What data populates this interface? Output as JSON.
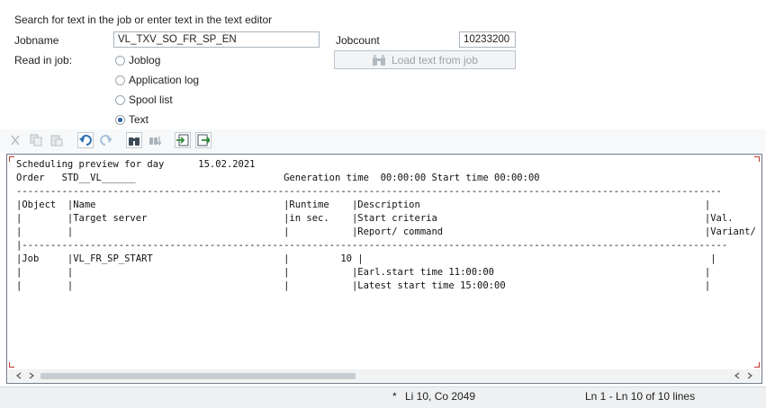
{
  "form": {
    "instruction": "Search for text in the job or enter text in the text editor",
    "jobname_label": "Jobname",
    "jobname_value": "VL_TXV_SO_FR_SP_EN",
    "jobcount_label": "Jobcount",
    "jobcount_value": "10233200",
    "read_in_job_label": "Read in job:",
    "load_button_label": "Load text from job",
    "options": [
      {
        "label": "Joblog",
        "selected": false
      },
      {
        "label": "Application log",
        "selected": false
      },
      {
        "label": "Spool list",
        "selected": false
      },
      {
        "label": "Text",
        "selected": true
      }
    ]
  },
  "toolbar": {
    "icons": [
      "cut-icon",
      "copy-icon",
      "paste-icon",
      "undo-icon",
      "redo-icon",
      "find-icon",
      "find-next-icon",
      "import-icon",
      "export-icon"
    ]
  },
  "editor": {
    "lines": [
      "Scheduling preview for day      15.02.2021",
      "Order   STD__VL______                          Generation time  00:00:00 Start time 00:00:00",
      "----------------------------------------------------------------------------------------------------------------------------",
      "|Object  |Name                                 |Runtime    |Description                                                  |",
      "|        |Target server                        |in sec.    |Start criteria                                               |Val.",
      "|        |                                     |           |Report/ command                                              |Variant/ p",
      "|----------------------------------------------------------------------------------------------------------------------------",
      "|Job     |VL_FR_SP_START                       |         10 |                                                             |",
      "|        |                                     |           |Earl.start time 11:00:00                                     |",
      "|        |                                     |           |Latest start time 15:00:00                                   |"
    ]
  },
  "status": {
    "modified_marker": "*",
    "cursor_position": "Li 10, Co 2049",
    "line_range": "Ln 1 - Ln 10 of 10 lines"
  }
}
